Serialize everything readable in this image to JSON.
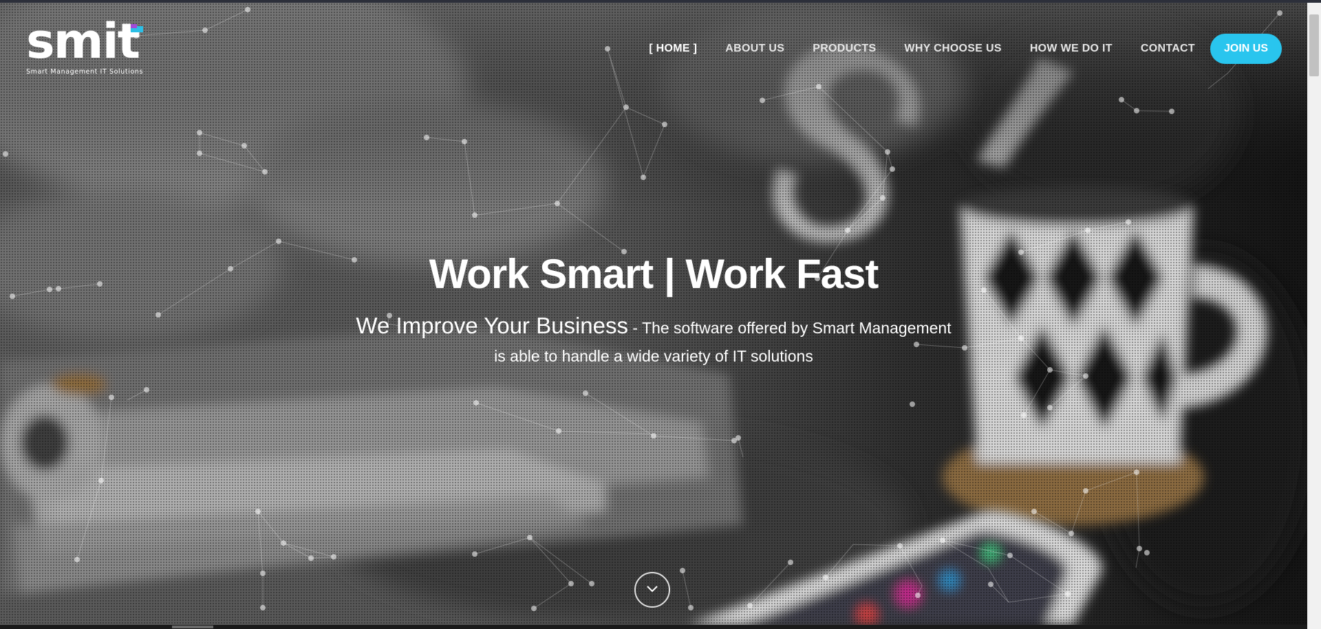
{
  "brand": {
    "wordmark": "smit",
    "tagline": "Smart Management IT Solutions",
    "accent_color": "#29c5ee",
    "flag_colors": [
      "#2bbfe6",
      "#a14bd8"
    ]
  },
  "nav": {
    "items": [
      {
        "label": "[ HOME ]",
        "active": true
      },
      {
        "label": "ABOUT US",
        "active": false
      },
      {
        "label": "PRODUCTS",
        "active": false
      },
      {
        "label": "WHY CHOOSE US",
        "active": false
      },
      {
        "label": "HOW WE DO IT",
        "active": false
      },
      {
        "label": "CONTACT",
        "active": false
      }
    ],
    "cta_label": "JOIN US"
  },
  "hero": {
    "title": "Work Smart | Work Fast",
    "subtitle_lead": "We Improve Your Business",
    "subtitle_rest": " - The software offered by Smart Management",
    "subtitle_line2": "is able to handle a wide variety of IT solutions",
    "scroll_icon": "chevron-down-icon"
  }
}
